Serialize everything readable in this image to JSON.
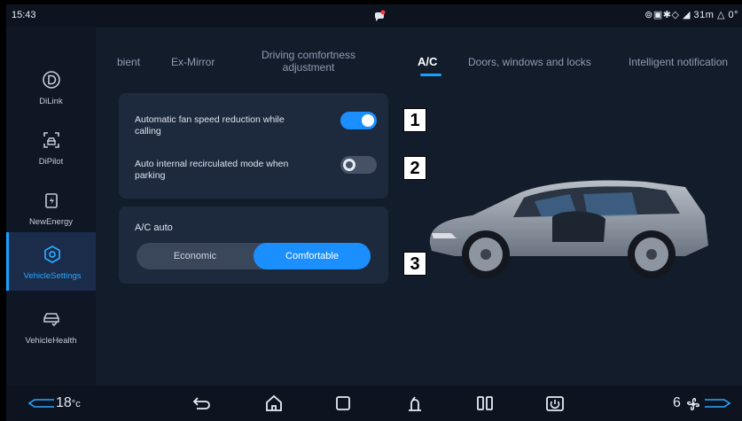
{
  "status": {
    "time": "15:43",
    "right_text": "⊚▣✱◇ ◢ 31m △ 0°"
  },
  "sidebar": {
    "items": [
      {
        "label": "DiLink",
        "icon": "dilink-icon"
      },
      {
        "label": "DiPilot",
        "icon": "dipilot-icon"
      },
      {
        "label": "NewEnergy",
        "icon": "battery-icon"
      },
      {
        "label": "VehicleSettings",
        "icon": "vehicle-settings-icon",
        "active": true
      },
      {
        "label": "VehicleHealth",
        "icon": "vehicle-health-icon"
      }
    ]
  },
  "tabs": [
    {
      "label": "bient"
    },
    {
      "label": "Ex-Mirror"
    },
    {
      "label_line1": "Driving comfortness",
      "label_line2": "adjustment"
    },
    {
      "label": "A/C",
      "active": true
    },
    {
      "label": "Doors, windows and locks"
    },
    {
      "label": "Intelligent notification"
    }
  ],
  "settings": {
    "fan_reduction": {
      "line1": "Automatic fan speed reduction while",
      "line2": "calling",
      "on": true
    },
    "recirculation": {
      "line1": "Auto internal recirculated mode when",
      "line2": "parking",
      "on": false
    }
  },
  "ac_auto": {
    "title": "A/C auto",
    "options": [
      "Economic",
      "Comfortable"
    ],
    "selected": "Comfortable"
  },
  "markers": [
    "1",
    "2",
    "3"
  ],
  "bottom": {
    "left_temp": "18",
    "left_unit": "°c",
    "fan_level": "6"
  },
  "colors": {
    "accent": "#1c8fff",
    "background": "#131c2b",
    "card": "#1d2a3e"
  }
}
